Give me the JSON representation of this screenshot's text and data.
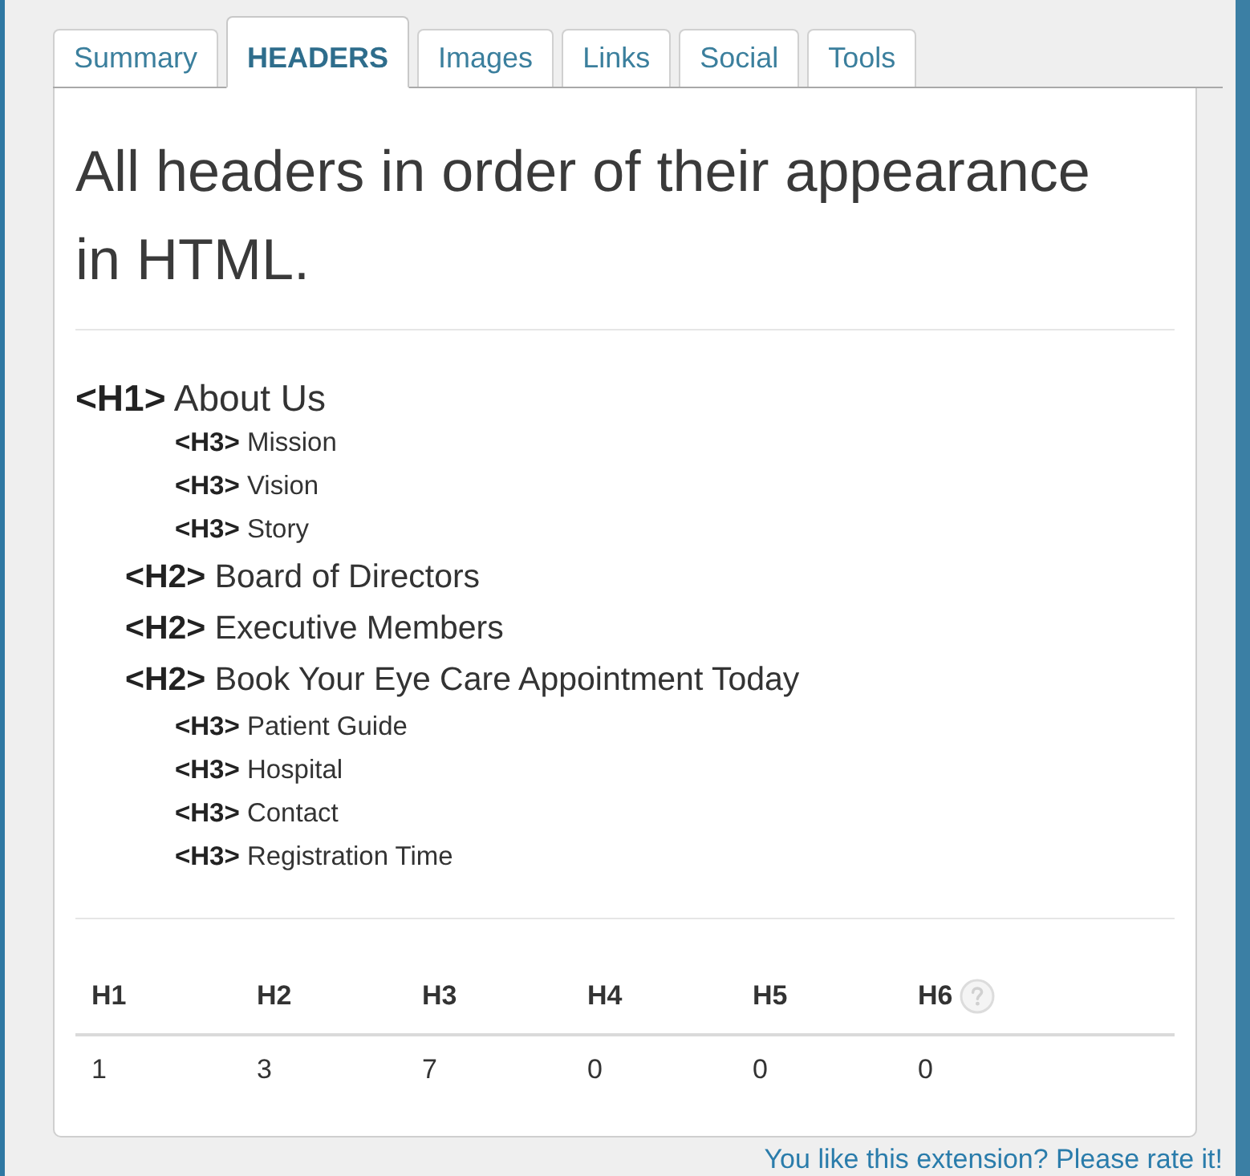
{
  "tabs": [
    {
      "label": "Summary",
      "selected": false
    },
    {
      "label": "HEADERS",
      "selected": true
    },
    {
      "label": "Images",
      "selected": false
    },
    {
      "label": "Links",
      "selected": false
    },
    {
      "label": "Social",
      "selected": false
    },
    {
      "label": "Tools",
      "selected": false
    }
  ],
  "panel": {
    "title": "All headers in order of their appearance in HTML.",
    "headers": [
      {
        "kind": "h1",
        "tag": "<H1>",
        "text": "About Us"
      },
      {
        "kind": "h3",
        "tag": "<H3>",
        "text": "Mission"
      },
      {
        "kind": "h3",
        "tag": "<H3>",
        "text": "Vision"
      },
      {
        "kind": "h3",
        "tag": "<H3>",
        "text": "Story"
      },
      {
        "kind": "h2",
        "tag": "<H2>",
        "text": "Board of Directors"
      },
      {
        "kind": "h2",
        "tag": "<H2>",
        "text": "Executive Members"
      },
      {
        "kind": "h2",
        "tag": "<H2>",
        "text": "Book Your Eye Care Appointment Today"
      },
      {
        "kind": "h3",
        "tag": "<H3>",
        "text": "Patient Guide"
      },
      {
        "kind": "h3",
        "tag": "<H3>",
        "text": "Hospital"
      },
      {
        "kind": "h3",
        "tag": "<H3>",
        "text": "Contact"
      },
      {
        "kind": "h3",
        "tag": "<H3>",
        "text": "Registration Time"
      }
    ],
    "counts": {
      "columns": [
        {
          "label": "H1",
          "info_icon": false
        },
        {
          "label": "H2",
          "info_icon": false
        },
        {
          "label": "H3",
          "info_icon": false
        },
        {
          "label": "H4",
          "info_icon": false
        },
        {
          "label": "H5",
          "info_icon": false
        },
        {
          "label": "H6",
          "info_icon": true
        }
      ],
      "values": [
        "1",
        "3",
        "7",
        "0",
        "0",
        "0"
      ]
    }
  },
  "footer_link": "You like this extension? Please rate it!"
}
